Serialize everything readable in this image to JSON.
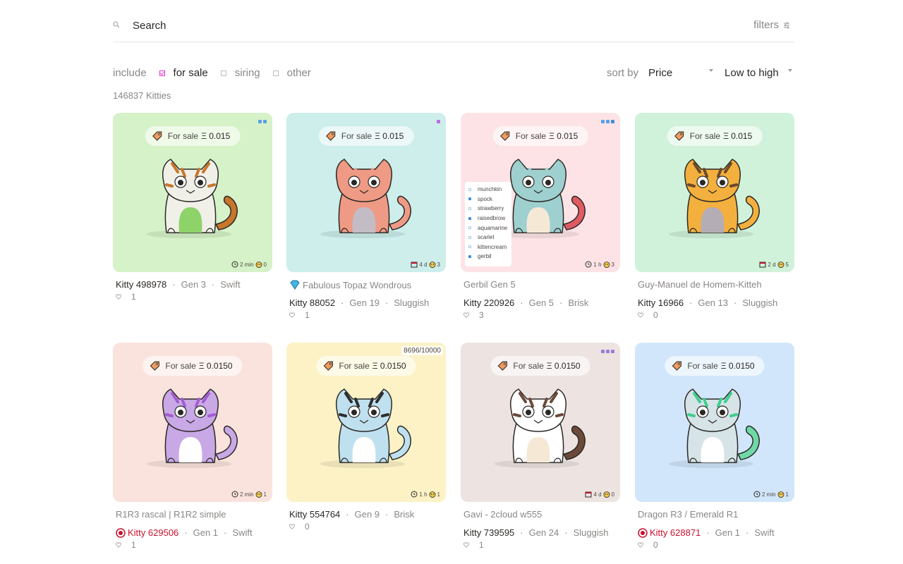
{
  "search": {
    "placeholder": "Search",
    "filters_label": "filters"
  },
  "include": {
    "label": "include",
    "options": [
      {
        "label": "for sale",
        "checked": true
      },
      {
        "label": "siring",
        "checked": false
      },
      {
        "label": "other",
        "checked": false
      }
    ]
  },
  "sort": {
    "label": "sort by",
    "field": "Price",
    "order": "Low to high"
  },
  "count_label": "146837 Kitties",
  "colors": {
    "accent": "#e23ad1",
    "fancy_red": "#c8102e"
  },
  "cards": [
    {
      "bg": "#d6f2c8",
      "badge_label": "For sale",
      "price": "Ξ 0.015",
      "meta_time": "2 min",
      "meta_count": "0",
      "meta_icon": "clock-icon",
      "title": "",
      "name": "Kitty 498978",
      "gen": "Gen 3",
      "speed": "Swift",
      "likes": "1",
      "fur": "#f0f0e8",
      "spots": "#c7762a",
      "belly": "#8ed36a",
      "tail": "#c7762a",
      "corner": [
        "#5aa0e8",
        "#5aa0e8"
      ]
    },
    {
      "bg": "#cdeeeb",
      "badge_label": "For sale",
      "price": "Ξ 0.015",
      "meta_time": "4 d",
      "meta_count": "3",
      "meta_icon": "calendar-icon",
      "title": "Fabulous Topaz Wondrous",
      "title_icon": "gem-icon",
      "name": "Kitty 88052",
      "gen": "Gen 19",
      "speed": "Sluggish",
      "likes": "1",
      "fur": "#ef9a84",
      "spots": "#ef9a84",
      "belly": "#c3bcc4",
      "tail": "#ef9a84",
      "corner": [
        "#c06ae0"
      ]
    },
    {
      "bg": "#fde3e6",
      "badge_label": "For sale",
      "price": "Ξ 0.015",
      "meta_time": "1 h",
      "meta_count": "3",
      "meta_icon": "clock-icon",
      "title": "Gerbil Gen 5",
      "name": "Kitty 220926",
      "gen": "Gen 5",
      "speed": "Brisk",
      "likes": "3",
      "fur": "#9fd0d0",
      "spots": "#9fd0d0",
      "belly": "#f5e9d6",
      "tail": "#e05a62",
      "corner": [
        "#5aa0e8",
        "#5aa0e8",
        "#3d8fd9"
      ],
      "attributes": [
        "munchkin",
        "spock",
        "strawberry",
        "raisedbrow",
        "aquamarine",
        "scarlet",
        "kittencream",
        "gerbil"
      ]
    },
    {
      "bg": "#d0f2da",
      "badge_label": "For sale",
      "price": "Ξ 0.015",
      "meta_time": "2 d",
      "meta_count": "5",
      "meta_icon": "calendar-icon",
      "title": "Guy-Manuel de Homem-Kitteh",
      "name": "Kitty 16966",
      "gen": "Gen 13",
      "speed": "Sluggish",
      "likes": "0",
      "fur": "#f3b03e",
      "spots": "#6b4b2a",
      "belly": "#b5adb5",
      "tail": "#f3b03e",
      "corner": []
    },
    {
      "bg": "#fbe3dd",
      "badge_label": "For sale",
      "price": "Ξ 0.0150",
      "meta_time": "2 min",
      "meta_count": "1",
      "meta_icon": "clock-icon",
      "title": "R1R3 rascal | R1R2 simple",
      "name": "Kitty 629506",
      "name_fancy": true,
      "gen": "Gen 1",
      "speed": "Swift",
      "likes": "1",
      "fur": "#c9a8e6",
      "spots": "#a35cd0",
      "belly": "#ffffff",
      "tail": "#c9a8e6",
      "corner": []
    },
    {
      "bg": "#fcf2c6",
      "badge_label": "For sale",
      "price": "Ξ 0.0150",
      "meta_time": "1 h",
      "meta_count": "1",
      "meta_icon": "clock-icon",
      "title": "",
      "edition": "8696/10000",
      "name": "Kitty 554764",
      "gen": "Gen 9",
      "speed": "Brisk",
      "likes": "0",
      "fur": "#bfe0ef",
      "spots": "#2f2f2f",
      "belly": "#ffffff",
      "tail": "#bfe0ef",
      "corner": []
    },
    {
      "bg": "#ede4e1",
      "badge_label": "For sale",
      "price": "Ξ 0.0150",
      "meta_time": "4 d",
      "meta_count": "0",
      "meta_icon": "calendar-icon",
      "title": "Gavi - 2cloud w555",
      "name": "Kitty 739595",
      "gen": "Gen 24",
      "speed": "Sluggish",
      "likes": "1",
      "fur": "#ffffff",
      "spots": "#6b4a3a",
      "belly": "#f5e9d6",
      "tail": "#6b4a3a",
      "corner": [
        "#9d7ae0",
        "#9d7ae0",
        "#9d7ae0"
      ]
    },
    {
      "bg": "#d2e6fb",
      "badge_label": "For sale",
      "price": "Ξ 0.0150",
      "meta_time": "2 min",
      "meta_count": "1",
      "meta_icon": "clock-icon",
      "title": "Dragon R3 / Emerald R1",
      "name": "Kitty 628871",
      "name_fancy": true,
      "gen": "Gen 1",
      "speed": "Swift",
      "likes": "0",
      "fur": "#d6e4e8",
      "spots": "#3ecf8e",
      "belly": "#ffffff",
      "tail": "#6fd9a6",
      "corner": []
    }
  ]
}
